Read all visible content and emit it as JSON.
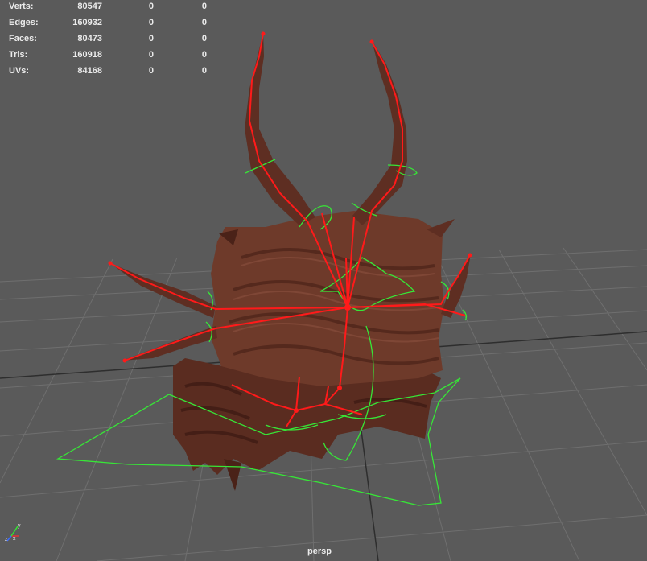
{
  "hud": {
    "rows": [
      {
        "label": "Verts:",
        "v1": "80547",
        "v2": "0",
        "v3": "0"
      },
      {
        "label": "Edges:",
        "v1": "160932",
        "v2": "0",
        "v3": "0"
      },
      {
        "label": "Faces:",
        "v1": "80473",
        "v2": "0",
        "v3": "0"
      },
      {
        "label": "Tris:",
        "v1": "160918",
        "v2": "0",
        "v3": "0"
      },
      {
        "label": "UVs:",
        "v1": "84168",
        "v2": "0",
        "v3": "0"
      }
    ]
  },
  "viewport": {
    "camera": "persp",
    "background": "#5a5a5a",
    "grid_color": "#6e6e6e",
    "axis_x": "x",
    "axis_y": "y",
    "axis_z": "z"
  },
  "colors": {
    "joint": "#ff1a1a",
    "control_curve": "#37e637",
    "mesh": "#6e3a2a"
  },
  "icons": {
    "axis_gizmo": "axis-gizmo-icon"
  }
}
